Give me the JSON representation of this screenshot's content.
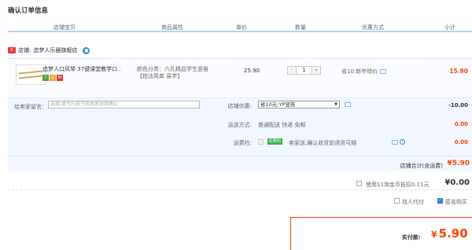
{
  "page_title": "确认订单信息",
  "columns": [
    "店铺宝贝",
    "商品属性",
    "单价",
    "数量",
    "优惠方式",
    "小计"
  ],
  "shop": {
    "icon_text": "tmall",
    "label": "店铺:",
    "name": "追梦人乐器旗舰店"
  },
  "item": {
    "title": "追梦人口风琴 37键课堂教学口...",
    "badges": [
      {
        "text": "7",
        "color": "#49a34c"
      },
      {
        "text": "◎",
        "color": "#f5a623"
      },
      {
        "text": "M",
        "color": "#e53333"
      }
    ],
    "attr": "颜色分类：六孔精品学生竖笛【指法简单 易学】",
    "price": "25.90",
    "qty": "1",
    "qty_minus": "-",
    "qty_plus": "+",
    "promo": "省10:新年特价",
    "subtotal": "15.90"
  },
  "message": {
    "label": "给卖家留言：",
    "placeholder": "选填:填写内容已和卖家协商确认"
  },
  "shop_discount": {
    "label": "店铺优惠:",
    "selected": "省10元:YP竖笛",
    "arrow": "▼",
    "value": "-10.00"
  },
  "shipping": {
    "label": "运送方式:",
    "text": "普通配送 快递 免邮",
    "value": "0.00"
  },
  "insurance": {
    "label": "运费险:",
    "tag": "运费险",
    "text": "卖家送,确认收货前退货可赔",
    "help": "?",
    "value": "0.00"
  },
  "shop_total": {
    "label": "店铺合计(含运费)",
    "value": "¥5.90"
  },
  "coins": {
    "text": "使用11淘金币抵扣0.11元",
    "value": "¥0.00"
  },
  "options": {
    "proxy": "找人代付",
    "anonymous": "匿名购买"
  },
  "payment": {
    "label": "实付款:",
    "currency": "¥",
    "value": "5.90"
  }
}
